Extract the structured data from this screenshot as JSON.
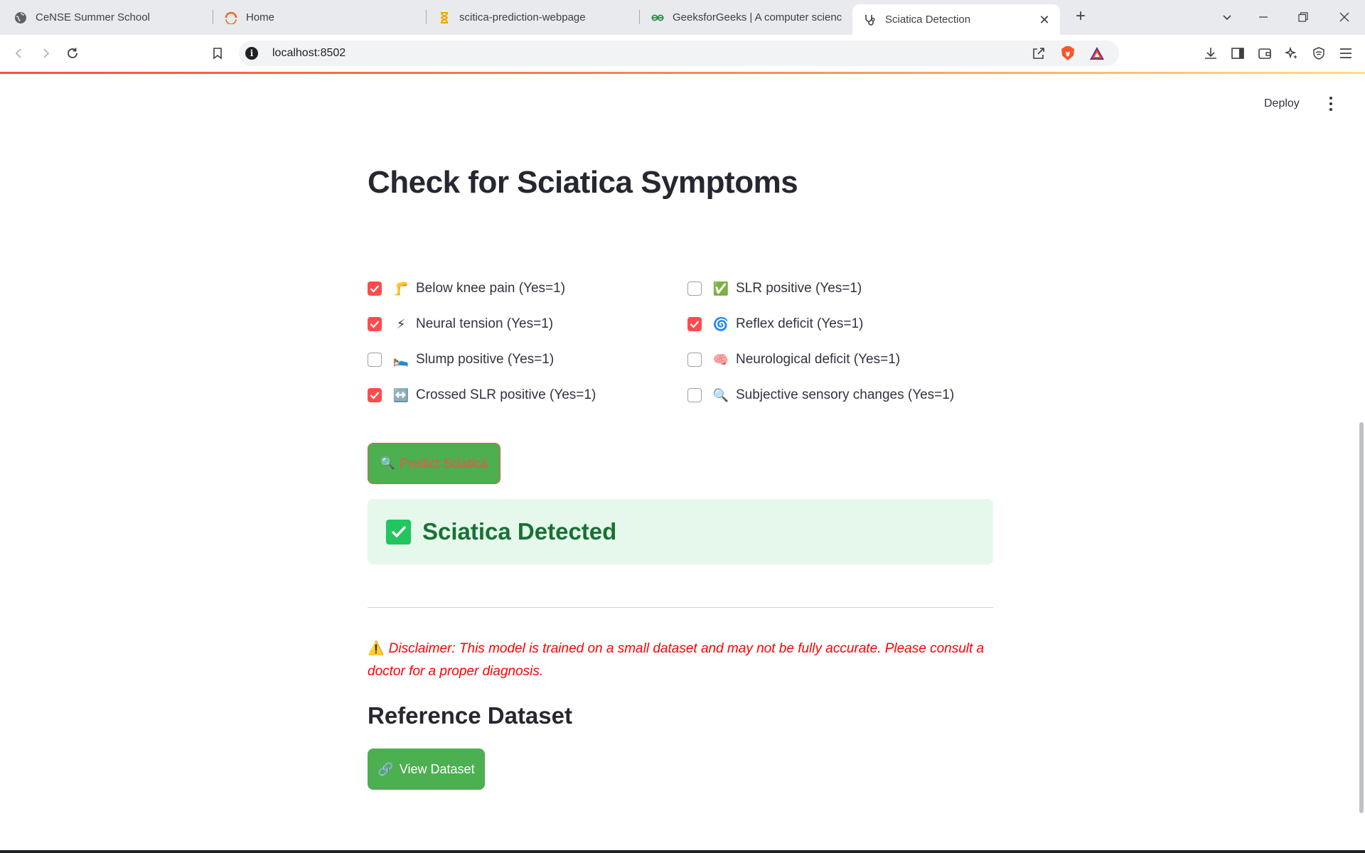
{
  "browser": {
    "tabs": [
      {
        "label": "CeNSE Summer School",
        "icon": "globe-icon"
      },
      {
        "label": "Home",
        "icon": "ring-logo-icon"
      },
      {
        "label": "scitica-prediction-webpage",
        "icon": "hourglass-icon"
      },
      {
        "label": "GeeksforGeeks | A computer scienc",
        "icon": "gfg-logo-icon"
      },
      {
        "label": "Sciatica Detection",
        "icon": "stethoscope-icon",
        "active": true
      }
    ],
    "url": "localhost:8502",
    "colors": {
      "tabstrip": "#e8eaed",
      "accent_start": "#ff4b4b",
      "accent_end": "#ffe082"
    }
  },
  "app": {
    "deploy_label": "Deploy",
    "title": "Check for Sciatica Symptoms",
    "symptoms": {
      "left": [
        {
          "label": "Below knee pain (Yes=1)",
          "emoji": "🦵",
          "checked": true
        },
        {
          "label": "Neural tension (Yes=1)",
          "emoji": "⚡",
          "checked": true
        },
        {
          "label": "Slump positive (Yes=1)",
          "emoji": "🛌",
          "checked": false
        },
        {
          "label": "Crossed SLR positive (Yes=1)",
          "emoji": "↔️",
          "checked": true
        }
      ],
      "right": [
        {
          "label": "SLR positive (Yes=1)",
          "emoji": "✅",
          "checked": false
        },
        {
          "label": "Reflex deficit (Yes=1)",
          "emoji": "🌀",
          "checked": true
        },
        {
          "label": "Neurological deficit (Yes=1)",
          "emoji": "🧠",
          "checked": false
        },
        {
          "label": "Subjective sensory changes (Yes=1)",
          "emoji": "🔍",
          "checked": false
        }
      ]
    },
    "predict_button": {
      "icon": "🔍",
      "label": "Predict Sciatica"
    },
    "result": {
      "icon": "✅",
      "text": "Sciatica Detected"
    },
    "disclaimer": {
      "icon": "⚠️",
      "text": "Disclaimer: This model is trained on a small dataset and may not be fully accurate. Please consult a doctor for a proper diagnosis."
    },
    "reference_heading": "Reference Dataset",
    "view_button": {
      "icon": "🔗",
      "label": "View Dataset"
    },
    "colors": {
      "checkbox_on": "#ff4b4b",
      "button_green": "#4caf50",
      "success_bg": "#e6f8ec",
      "success_text": "#177233",
      "disclaimer": "#ff0000"
    }
  }
}
